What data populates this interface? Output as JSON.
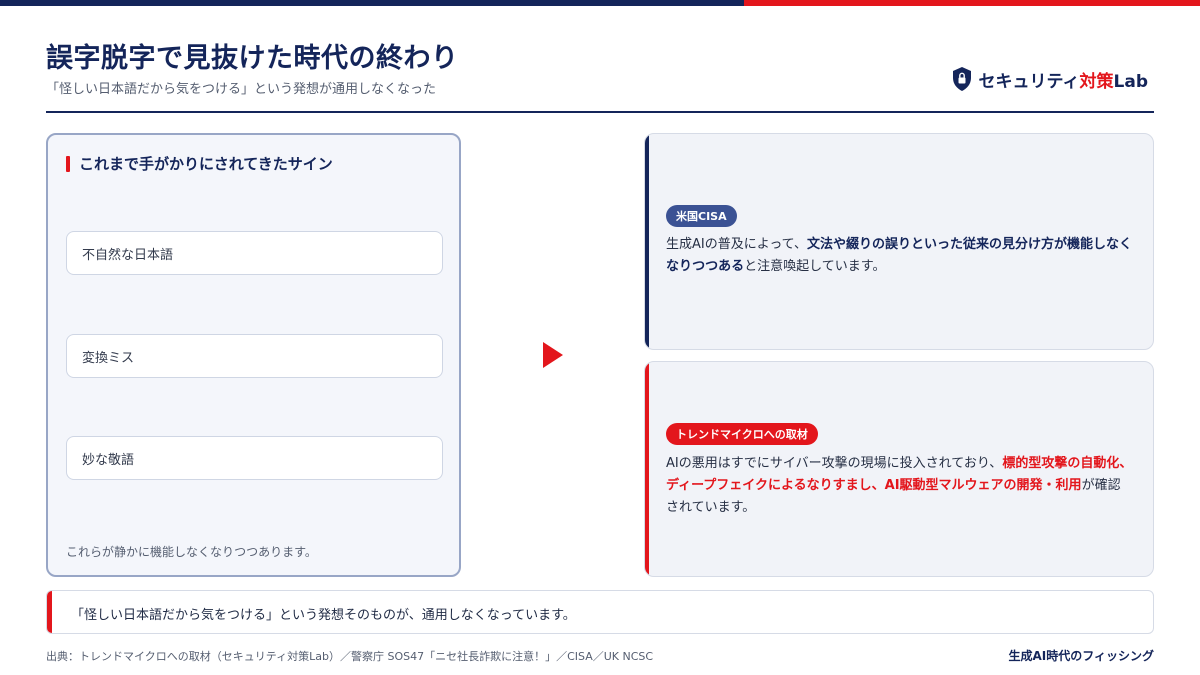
{
  "colors": {
    "navy": "#14255a",
    "red": "#e3161c",
    "panel_bg": "#f4f6fb",
    "card_bg": "#f1f3f8",
    "badge_navy": "#3b5294"
  },
  "header": {
    "title": "誤字脱字で見抜けた時代の終わり",
    "subtitle": "「怪しい日本語だから気をつける」という発想が通用しなくなった"
  },
  "brand": {
    "icon": "shield-lock-icon",
    "name_part1": "セキュリティ",
    "name_accent": "対策",
    "name_part2": "Lab"
  },
  "left_panel": {
    "heading": "これまで手がかりにされてきたサイン",
    "signs": [
      "不自然な日本語",
      "変換ミス",
      "妙な敬語"
    ],
    "note": "これらが静かに機能しなくなりつつあります。"
  },
  "arrow_icon": "triangle-right-icon",
  "cards": [
    {
      "badge": "米国CISA",
      "text_a": "生成AIの普及によって、",
      "text_b": "文法や綴りの誤りといった従来の見分け方が機能しなくなりつつある",
      "text_c": "と注意喚起しています。"
    },
    {
      "badge": "トレンドマイクロへの取材",
      "text_a": "AIの悪用はすでにサイバー攻撃の現場に投入されており、",
      "text_b": "標的型攻撃の自動化、ディープフェイクによるなりすまし、AI駆動型マルウェアの開発・利用",
      "text_c": "が確認されています。"
    }
  ],
  "conclusion": "「怪しい日本語だから気をつける」という発想そのものが、通用しなくなっています。",
  "footer": {
    "source": "出典：トレンドマイクロへの取材（セキュリティ対策Lab）／警察庁 SOS47「ニセ社長詐欺に注意！」／CISA／UK NCSC",
    "series": "生成AI時代のフィッシング"
  }
}
